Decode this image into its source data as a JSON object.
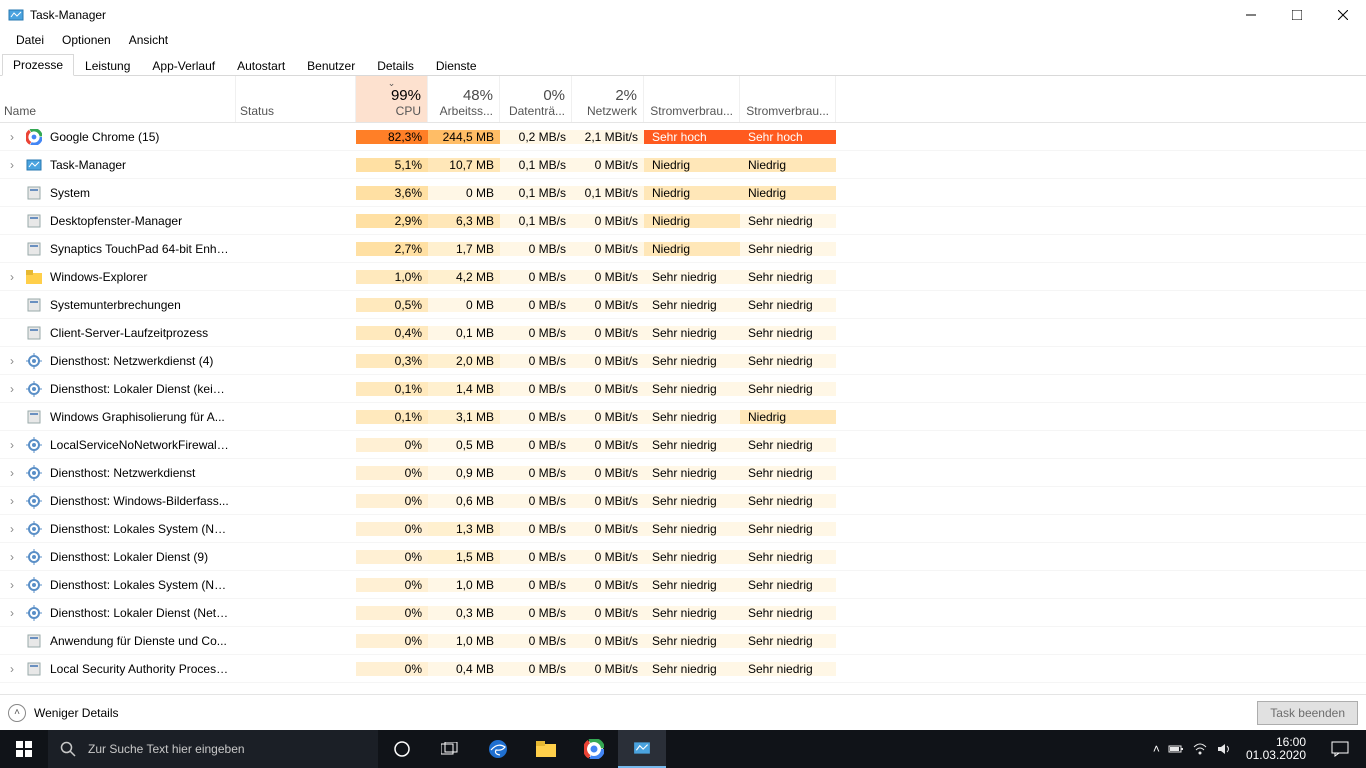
{
  "window": {
    "title": "Task-Manager",
    "menus": [
      "Datei",
      "Optionen",
      "Ansicht"
    ],
    "tabs": [
      "Prozesse",
      "Leistung",
      "App-Verlauf",
      "Autostart",
      "Benutzer",
      "Details",
      "Dienste"
    ],
    "active_tab": 0
  },
  "columns": {
    "name": "Name",
    "status": "Status",
    "cpu": {
      "pct": "99%",
      "label": "CPU"
    },
    "mem": {
      "pct": "48%",
      "label": "Arbeitss..."
    },
    "disk": {
      "pct": "0%",
      "label": "Datenträ..."
    },
    "net": {
      "pct": "2%",
      "label": "Netzwerk"
    },
    "p1": {
      "pct": "",
      "label": "Stromverbrau..."
    },
    "p2": {
      "pct": "",
      "label": "Stromverbrau..."
    }
  },
  "rows": [
    {
      "exp": true,
      "icon": "chrome",
      "name": "Google Chrome (15)",
      "cpu": "82,3%",
      "mem": "244,5 MB",
      "disk": "0,2 MB/s",
      "net": "2,1 MBit/s",
      "p1": "Sehr hoch",
      "p2": "Sehr hoch",
      "heat": "vhigh"
    },
    {
      "exp": true,
      "icon": "tm",
      "name": "Task-Manager",
      "cpu": "5,1%",
      "mem": "10,7 MB",
      "disk": "0,1 MB/s",
      "net": "0 MBit/s",
      "p1": "Niedrig",
      "p2": "Niedrig",
      "heat": "low"
    },
    {
      "exp": false,
      "icon": "sys",
      "name": "System",
      "cpu": "3,6%",
      "mem": "0 MB",
      "disk": "0,1 MB/s",
      "net": "0,1 MBit/s",
      "p1": "Niedrig",
      "p2": "Niedrig",
      "heat": "low"
    },
    {
      "exp": false,
      "icon": "dwm",
      "name": "Desktopfenster-Manager",
      "cpu": "2,9%",
      "mem": "6,3 MB",
      "disk": "0,1 MB/s",
      "net": "0 MBit/s",
      "p1": "Niedrig",
      "p2": "Sehr niedrig",
      "heat": "low"
    },
    {
      "exp": false,
      "icon": "gen",
      "name": "Synaptics TouchPad 64-bit Enha...",
      "cpu": "2,7%",
      "mem": "1,7 MB",
      "disk": "0 MB/s",
      "net": "0 MBit/s",
      "p1": "Niedrig",
      "p2": "Sehr niedrig",
      "heat": "low"
    },
    {
      "exp": true,
      "icon": "folder",
      "name": "Windows-Explorer",
      "cpu": "1,0%",
      "mem": "4,2 MB",
      "disk": "0 MB/s",
      "net": "0 MBit/s",
      "p1": "Sehr niedrig",
      "p2": "Sehr niedrig",
      "heat": "vlow"
    },
    {
      "exp": false,
      "icon": "sys",
      "name": "Systemunterbrechungen",
      "cpu": "0,5%",
      "mem": "0 MB",
      "disk": "0 MB/s",
      "net": "0 MBit/s",
      "p1": "Sehr niedrig",
      "p2": "Sehr niedrig",
      "heat": "vlow"
    },
    {
      "exp": false,
      "icon": "gen",
      "name": "Client-Server-Laufzeitprozess",
      "cpu": "0,4%",
      "mem": "0,1 MB",
      "disk": "0 MB/s",
      "net": "0 MBit/s",
      "p1": "Sehr niedrig",
      "p2": "Sehr niedrig",
      "heat": "vlow"
    },
    {
      "exp": true,
      "icon": "svc",
      "name": "Diensthost: Netzwerkdienst (4)",
      "cpu": "0,3%",
      "mem": "2,0 MB",
      "disk": "0 MB/s",
      "net": "0 MBit/s",
      "p1": "Sehr niedrig",
      "p2": "Sehr niedrig",
      "heat": "vlow"
    },
    {
      "exp": true,
      "icon": "svc",
      "name": "Diensthost: Lokaler Dienst (kein ...",
      "cpu": "0,1%",
      "mem": "1,4 MB",
      "disk": "0 MB/s",
      "net": "0 MBit/s",
      "p1": "Sehr niedrig",
      "p2": "Sehr niedrig",
      "heat": "vlow"
    },
    {
      "exp": false,
      "icon": "gen",
      "name": "Windows Graphisolierung für A...",
      "cpu": "0,1%",
      "mem": "3,1 MB",
      "disk": "0 MB/s",
      "net": "0 MBit/s",
      "p1": "Sehr niedrig",
      "p2": "Niedrig",
      "heat": "vlow"
    },
    {
      "exp": true,
      "icon": "svc",
      "name": "LocalServiceNoNetworkFirewall ...",
      "cpu": "0%",
      "mem": "0,5 MB",
      "disk": "0 MB/s",
      "net": "0 MBit/s",
      "p1": "Sehr niedrig",
      "p2": "Sehr niedrig",
      "heat": "zero"
    },
    {
      "exp": true,
      "icon": "svc",
      "name": "Diensthost: Netzwerkdienst",
      "cpu": "0%",
      "mem": "0,9 MB",
      "disk": "0 MB/s",
      "net": "0 MBit/s",
      "p1": "Sehr niedrig",
      "p2": "Sehr niedrig",
      "heat": "zero"
    },
    {
      "exp": true,
      "icon": "svc",
      "name": "Diensthost: Windows-Bilderfass...",
      "cpu": "0%",
      "mem": "0,6 MB",
      "disk": "0 MB/s",
      "net": "0 MBit/s",
      "p1": "Sehr niedrig",
      "p2": "Sehr niedrig",
      "heat": "zero"
    },
    {
      "exp": true,
      "icon": "svc",
      "name": "Diensthost: Lokales System (Net...",
      "cpu": "0%",
      "mem": "1,3 MB",
      "disk": "0 MB/s",
      "net": "0 MBit/s",
      "p1": "Sehr niedrig",
      "p2": "Sehr niedrig",
      "heat": "zero"
    },
    {
      "exp": true,
      "icon": "svc",
      "name": "Diensthost: Lokaler Dienst (9)",
      "cpu": "0%",
      "mem": "1,5 MB",
      "disk": "0 MB/s",
      "net": "0 MBit/s",
      "p1": "Sehr niedrig",
      "p2": "Sehr niedrig",
      "heat": "zero"
    },
    {
      "exp": true,
      "icon": "svc",
      "name": "Diensthost: Lokales System (Net...",
      "cpu": "0%",
      "mem": "1,0 MB",
      "disk": "0 MB/s",
      "net": "0 MBit/s",
      "p1": "Sehr niedrig",
      "p2": "Sehr niedrig",
      "heat": "zero"
    },
    {
      "exp": true,
      "icon": "svc",
      "name": "Diensthost: Lokaler Dienst (Netz...",
      "cpu": "0%",
      "mem": "0,3 MB",
      "disk": "0 MB/s",
      "net": "0 MBit/s",
      "p1": "Sehr niedrig",
      "p2": "Sehr niedrig",
      "heat": "zero"
    },
    {
      "exp": false,
      "icon": "gen",
      "name": "Anwendung für Dienste und Co...",
      "cpu": "0%",
      "mem": "1,0 MB",
      "disk": "0 MB/s",
      "net": "0 MBit/s",
      "p1": "Sehr niedrig",
      "p2": "Sehr niedrig",
      "heat": "zero"
    },
    {
      "exp": true,
      "icon": "gen",
      "name": "Local Security Authority Process...",
      "cpu": "0%",
      "mem": "0,4 MB",
      "disk": "0 MB/s",
      "net": "0 MBit/s",
      "p1": "Sehr niedrig",
      "p2": "Sehr niedrig",
      "heat": "zero"
    }
  ],
  "footer": {
    "fewer_details": "Weniger Details",
    "end_task": "Task beenden"
  },
  "taskbar": {
    "search_placeholder": "Zur Suche Text hier eingeben",
    "time": "16:00",
    "date": "01.03.2020"
  }
}
